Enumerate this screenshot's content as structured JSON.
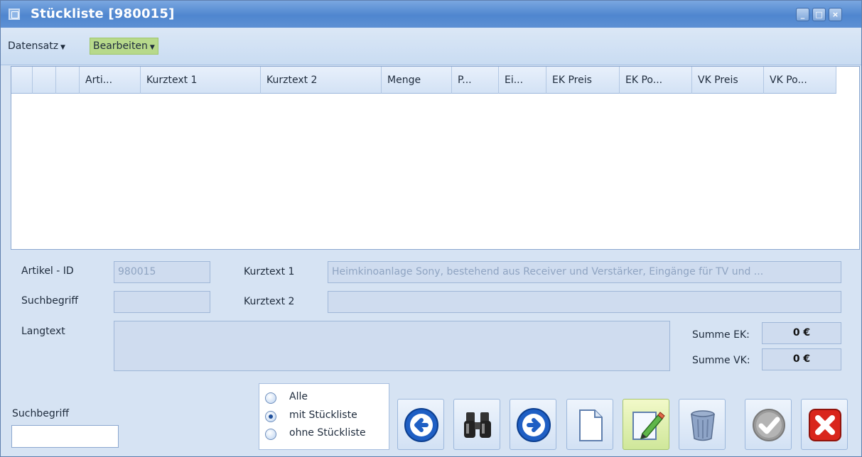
{
  "window": {
    "title": "Stückliste [980015]"
  },
  "menu": {
    "datensatz": "Datensatz",
    "bearbeiten": "Bearbeiten"
  },
  "grid": {
    "columns": [
      "",
      "",
      "",
      "Arti...",
      "Kurztext 1",
      "Kurztext 2",
      "Menge",
      "P...",
      "Ei...",
      "EK Preis",
      "EK Po...",
      "VK Preis",
      "VK Po..."
    ],
    "rows": []
  },
  "form": {
    "artikel_id_label": "Artikel - ID",
    "artikel_id_value": "980015",
    "suchbegriff_label": "Suchbegriff",
    "suchbegriff_value": "",
    "kurztext1_label": "Kurztext 1",
    "kurztext1_value": "Heimkinoanlage Sony, bestehend aus Receiver und Verstärker, Eingänge für TV und ...",
    "kurztext2_label": "Kurztext 2",
    "kurztext2_value": "",
    "langtext_label": "Langtext",
    "langtext_value": "",
    "summe_ek_label": "Summe EK:",
    "summe_ek_value": "0 €",
    "summe_vk_label": "Summe VK:",
    "summe_vk_value": "0 €"
  },
  "search": {
    "label": "Suchbegriff",
    "value": ""
  },
  "filter": {
    "options": [
      "Alle",
      "mit Stückliste",
      "ohne Stückliste"
    ],
    "selected": "mit Stückliste"
  },
  "toolbar": {
    "icons": [
      "back-arrow-icon",
      "binoculars-icon",
      "forward-arrow-icon",
      "new-document-icon",
      "edit-pencil-icon",
      "delete-trash-icon",
      "confirm-check-icon",
      "cancel-x-icon"
    ],
    "active": "edit-pencil-icon"
  },
  "colors": {
    "accent": "#4f86cf",
    "highlight": "#b7d98b",
    "field": "#cfdcef",
    "cancel": "#d9261c"
  }
}
